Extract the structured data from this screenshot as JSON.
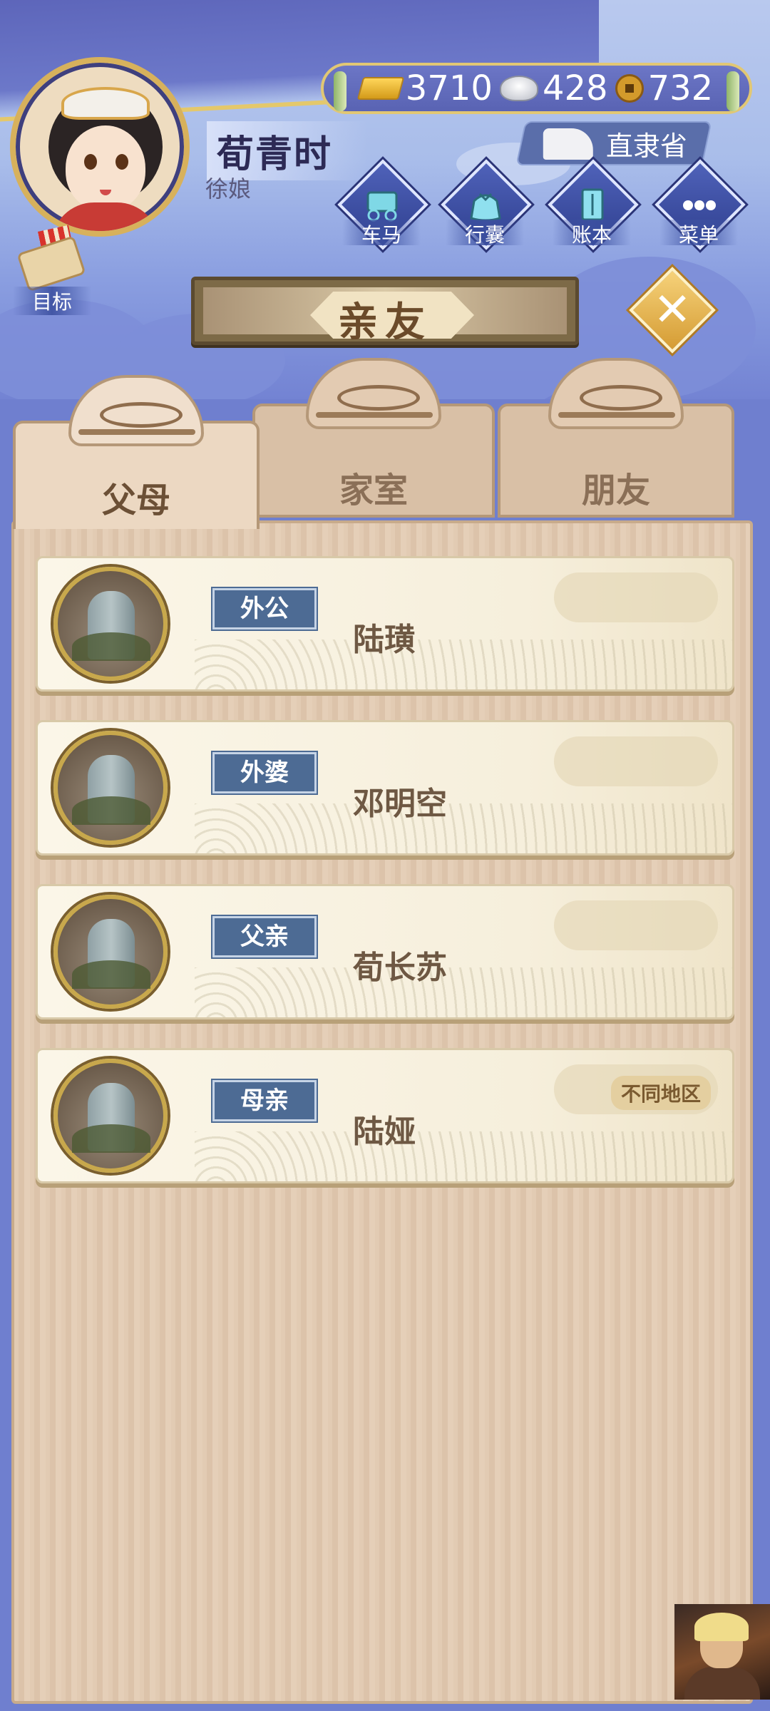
{
  "player": {
    "name": "荀青时",
    "title": "徐娘"
  },
  "currency": {
    "gold": "3710",
    "silver": "428",
    "copper": "732"
  },
  "location": "直隶省",
  "menu": {
    "carriage": "车马",
    "luggage": "行囊",
    "ledger": "账本",
    "menu": "菜单",
    "goal": "目标"
  },
  "panel": {
    "title": "亲友",
    "close_icon": "close-icon"
  },
  "tabs": [
    {
      "label": "父母"
    },
    {
      "label": "家室"
    },
    {
      "label": "朋友"
    }
  ],
  "relatives": [
    {
      "relation": "外公",
      "name": "陆璜",
      "note": ""
    },
    {
      "relation": "外婆",
      "name": "邓明空",
      "note": ""
    },
    {
      "relation": "父亲",
      "name": "荀长苏",
      "note": ""
    },
    {
      "relation": "母亲",
      "name": "陆娅",
      "note": "不同地区"
    }
  ],
  "colors": {
    "accent_gold": "#e1c774",
    "badge_blue": "#4d6b94",
    "panel_wood": "#e2cbb3"
  }
}
